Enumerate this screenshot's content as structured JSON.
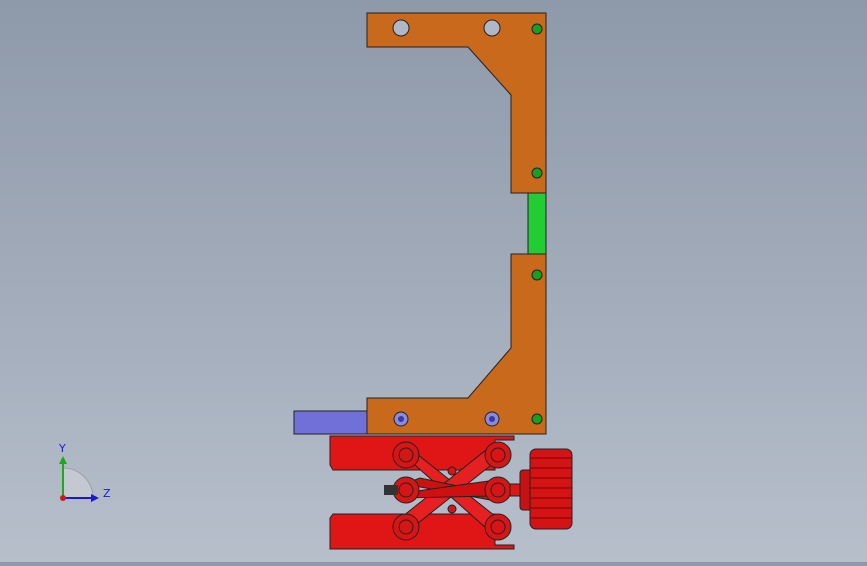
{
  "viewport": {
    "background_top": "#8e99aa",
    "background_bottom": "#b7bfcb"
  },
  "model": {
    "bracket_color": "#c8691c",
    "spacer_color": "#22cc33",
    "jack_color": "#e01515",
    "knob_color": "#d41414",
    "block_color": "#7070d8",
    "hole_fill": "#b0b7c6",
    "screw_color": "#18a020"
  },
  "triad": {
    "y_label": "Y",
    "z_label": "Z",
    "y_color": "#1aaa1a",
    "z_color": "#1a1acc",
    "origin_color": "#cc1a1a"
  }
}
